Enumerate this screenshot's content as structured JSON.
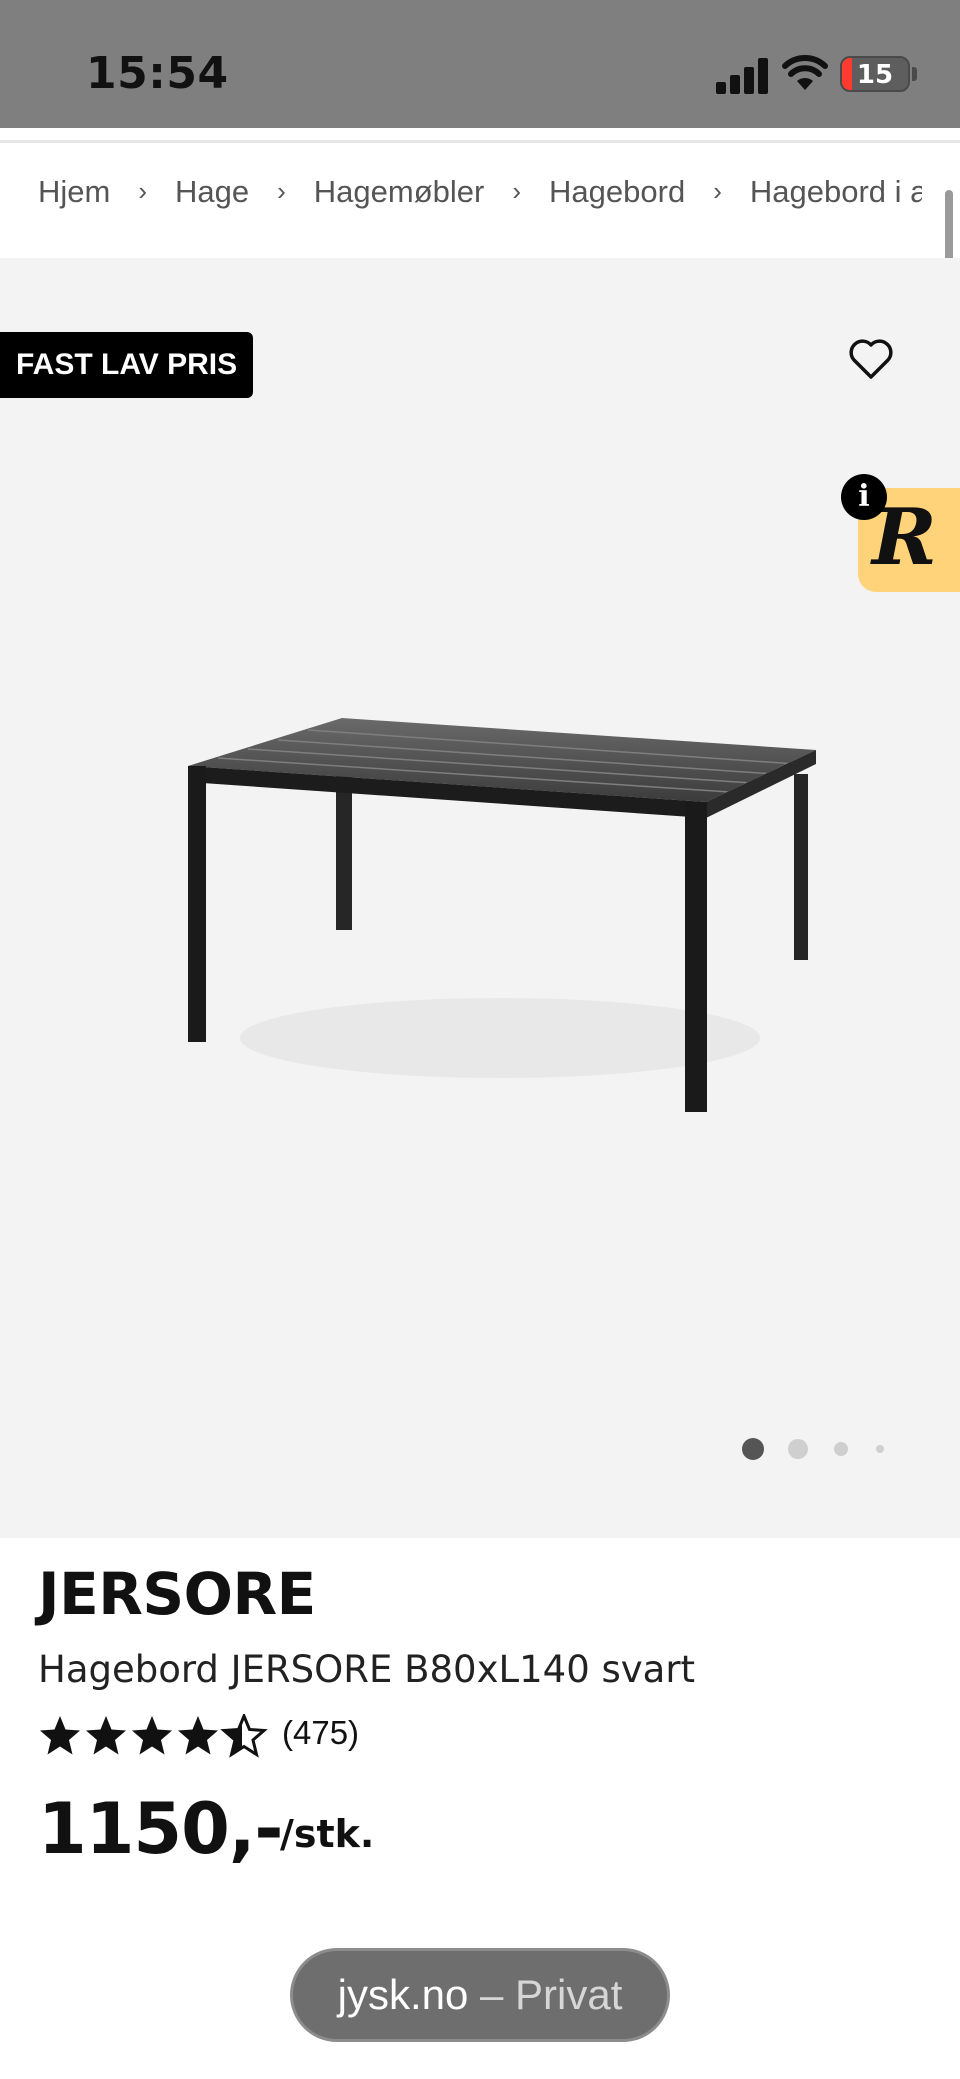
{
  "status_bar": {
    "time": "15:54",
    "battery_level": "15",
    "battery_color": "#ff3b30"
  },
  "breadcrumb": {
    "items": [
      "Hjem",
      "Hage",
      "Hagemøbler",
      "Hagebord",
      "Hagebord i ar"
    ],
    "separator": "›"
  },
  "gallery": {
    "badge": "FAST LAV PRIS",
    "favorite_icon": "heart-outline-icon",
    "info_badge": "i",
    "widget_logo": "R",
    "widget_color": "#ffd37a",
    "image_count": 4,
    "active_image": 1
  },
  "product": {
    "brand": "JERSORE",
    "name": "Hagebord JERSORE B80xL140 svart",
    "rating": 4.5,
    "rating_max": 5,
    "review_count": "(475)",
    "price": "1150,-",
    "unit": "/stk."
  },
  "browser": {
    "domain": "jysk.no",
    "mode": " – Privat"
  }
}
